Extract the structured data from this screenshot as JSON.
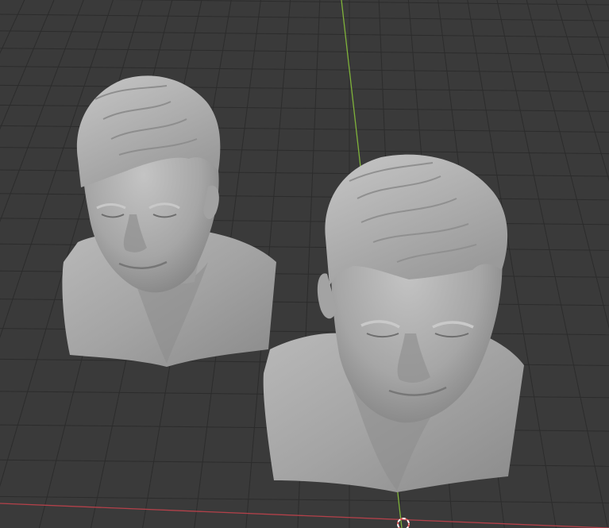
{
  "viewport": {
    "background": "#3a3a3a",
    "grid_color": "#2c2c2c",
    "grid_color_minor": "#333333",
    "x_axis_color": "#b3414a",
    "y_axis_color": "#7fb23a"
  },
  "scene_objects": [
    {
      "name": "bust-left",
      "type": "sculpted mesh bust",
      "material_color": "#a9a9a9"
    },
    {
      "name": "bust-right",
      "type": "sculpted mesh bust",
      "material_color": "#aeaeae"
    }
  ],
  "overlays": [
    {
      "name": "3d-cursor",
      "icon": "3d-cursor-icon"
    }
  ]
}
